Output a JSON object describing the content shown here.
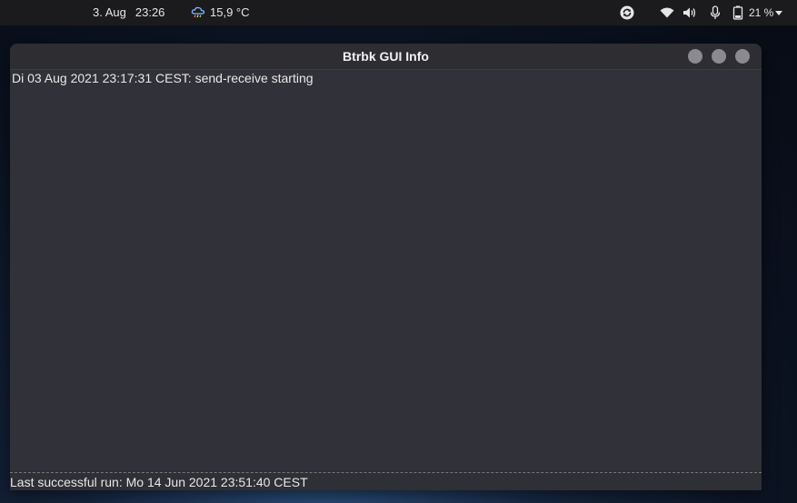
{
  "topbar": {
    "date": "3. Aug",
    "time": "23:26",
    "weather_temp": "15,9 °C",
    "weather_icon": "cloud-rain-icon",
    "battery_percent": "21 %",
    "status_icons": [
      "sync-icon",
      "wifi-icon",
      "volume-icon",
      "microphone-icon",
      "battery-icon",
      "chevron-down-icon"
    ]
  },
  "window": {
    "title": "Btrbk GUI Info",
    "log_line": "Di 03 Aug 2021 23:17:31 CEST: send-receive starting",
    "status": "Last successful run: Mo 14 Jun 2021 23:51:40 CEST",
    "controls": [
      "minimize-button",
      "maximize-button",
      "close-button"
    ]
  },
  "colors": {
    "topbar_bg": "#1b1b1d",
    "window_bg": "#313139",
    "titlebar_bg": "#2d2d32",
    "button_gray": "#8a8a90",
    "text": "#e8e8e8"
  }
}
